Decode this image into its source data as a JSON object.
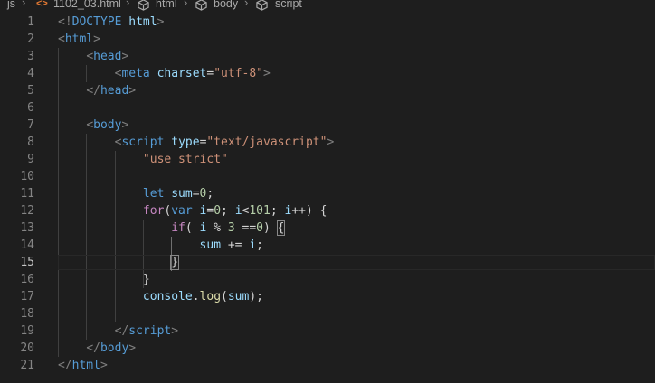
{
  "breadcrumb": {
    "folder": "js",
    "file": "1102_03.html",
    "html": "html",
    "body": "body",
    "script": "script"
  },
  "editor": {
    "current_line": 15,
    "lines": [
      {
        "n": "1",
        "tokens": [
          {
            "t": "<!",
            "c": "punc"
          },
          {
            "t": "DOCTYPE",
            "c": "tag"
          },
          {
            "t": " ",
            "c": "plain"
          },
          {
            "t": "html",
            "c": "attr"
          },
          {
            "t": ">",
            "c": "punc"
          }
        ]
      },
      {
        "n": "2",
        "tokens": [
          {
            "t": "<",
            "c": "punc"
          },
          {
            "t": "html",
            "c": "tag"
          },
          {
            "t": ">",
            "c": "punc"
          }
        ]
      },
      {
        "n": "3",
        "tokens": [
          {
            "t": "    ",
            "c": "plain"
          },
          {
            "t": "<",
            "c": "punc"
          },
          {
            "t": "head",
            "c": "tag"
          },
          {
            "t": ">",
            "c": "punc"
          }
        ]
      },
      {
        "n": "4",
        "tokens": [
          {
            "t": "        ",
            "c": "plain"
          },
          {
            "t": "<",
            "c": "punc"
          },
          {
            "t": "meta",
            "c": "tag"
          },
          {
            "t": " ",
            "c": "plain"
          },
          {
            "t": "charset",
            "c": "attr"
          },
          {
            "t": "=",
            "c": "plain"
          },
          {
            "t": "\"utf-8\"",
            "c": "str"
          },
          {
            "t": ">",
            "c": "punc"
          }
        ]
      },
      {
        "n": "5",
        "tokens": [
          {
            "t": "    ",
            "c": "plain"
          },
          {
            "t": "</",
            "c": "punc"
          },
          {
            "t": "head",
            "c": "tag"
          },
          {
            "t": ">",
            "c": "punc"
          }
        ]
      },
      {
        "n": "6",
        "tokens": []
      },
      {
        "n": "7",
        "tokens": [
          {
            "t": "    ",
            "c": "plain"
          },
          {
            "t": "<",
            "c": "punc"
          },
          {
            "t": "body",
            "c": "tag"
          },
          {
            "t": ">",
            "c": "punc"
          }
        ]
      },
      {
        "n": "8",
        "tokens": [
          {
            "t": "        ",
            "c": "plain"
          },
          {
            "t": "<",
            "c": "punc"
          },
          {
            "t": "script",
            "c": "tag"
          },
          {
            "t": " ",
            "c": "plain"
          },
          {
            "t": "type",
            "c": "attr"
          },
          {
            "t": "=",
            "c": "plain"
          },
          {
            "t": "\"text/javascript\"",
            "c": "str"
          },
          {
            "t": ">",
            "c": "punc"
          }
        ]
      },
      {
        "n": "9",
        "tokens": [
          {
            "t": "            ",
            "c": "plain"
          },
          {
            "t": "\"use strict\"",
            "c": "str"
          }
        ]
      },
      {
        "n": "10",
        "tokens": []
      },
      {
        "n": "11",
        "tokens": [
          {
            "t": "            ",
            "c": "plain"
          },
          {
            "t": "let",
            "c": "kw"
          },
          {
            "t": " ",
            "c": "plain"
          },
          {
            "t": "sum",
            "c": "var"
          },
          {
            "t": "=",
            "c": "plain"
          },
          {
            "t": "0",
            "c": "num"
          },
          {
            "t": ";",
            "c": "plain"
          }
        ]
      },
      {
        "n": "12",
        "tokens": [
          {
            "t": "            ",
            "c": "plain"
          },
          {
            "t": "for",
            "c": "ctrl"
          },
          {
            "t": "(",
            "c": "plain"
          },
          {
            "t": "var",
            "c": "kw"
          },
          {
            "t": " ",
            "c": "plain"
          },
          {
            "t": "i",
            "c": "var"
          },
          {
            "t": "=",
            "c": "plain"
          },
          {
            "t": "0",
            "c": "num"
          },
          {
            "t": "; ",
            "c": "plain"
          },
          {
            "t": "i",
            "c": "var"
          },
          {
            "t": "<",
            "c": "plain"
          },
          {
            "t": "101",
            "c": "num"
          },
          {
            "t": "; ",
            "c": "plain"
          },
          {
            "t": "i",
            "c": "var"
          },
          {
            "t": "++) {",
            "c": "plain"
          }
        ]
      },
      {
        "n": "13",
        "tokens": [
          {
            "t": "                ",
            "c": "plain"
          },
          {
            "t": "if",
            "c": "ctrl"
          },
          {
            "t": "( ",
            "c": "plain"
          },
          {
            "t": "i",
            "c": "var"
          },
          {
            "t": " % ",
            "c": "plain"
          },
          {
            "t": "3",
            "c": "num"
          },
          {
            "t": " ==",
            "c": "plain"
          },
          {
            "t": "0",
            "c": "num"
          },
          {
            "t": ") ",
            "c": "plain"
          },
          {
            "t": "{",
            "c": "plain",
            "m": true
          }
        ]
      },
      {
        "n": "14",
        "tokens": [
          {
            "t": "                    ",
            "c": "plain"
          },
          {
            "t": "sum",
            "c": "var"
          },
          {
            "t": " += ",
            "c": "plain"
          },
          {
            "t": "i",
            "c": "var"
          },
          {
            "t": ";",
            "c": "plain"
          }
        ]
      },
      {
        "n": "15",
        "tokens": [
          {
            "t": "                ",
            "c": "plain"
          },
          {
            "t": "}",
            "c": "plain",
            "m": true
          }
        ]
      },
      {
        "n": "16",
        "tokens": [
          {
            "t": "            ",
            "c": "plain"
          },
          {
            "t": "}",
            "c": "plain"
          }
        ]
      },
      {
        "n": "17",
        "tokens": [
          {
            "t": "            ",
            "c": "plain"
          },
          {
            "t": "console",
            "c": "var"
          },
          {
            "t": ".",
            "c": "plain"
          },
          {
            "t": "log",
            "c": "fn"
          },
          {
            "t": "(",
            "c": "plain"
          },
          {
            "t": "sum",
            "c": "var"
          },
          {
            "t": ");",
            "c": "plain"
          }
        ]
      },
      {
        "n": "18",
        "tokens": []
      },
      {
        "n": "19",
        "tokens": [
          {
            "t": "        ",
            "c": "plain"
          },
          {
            "t": "</",
            "c": "punc"
          },
          {
            "t": "script",
            "c": "tag"
          },
          {
            "t": ">",
            "c": "punc"
          }
        ]
      },
      {
        "n": "20",
        "tokens": [
          {
            "t": "    ",
            "c": "plain"
          },
          {
            "t": "</",
            "c": "punc"
          },
          {
            "t": "body",
            "c": "tag"
          },
          {
            "t": ">",
            "c": "punc"
          }
        ]
      },
      {
        "n": "21",
        "tokens": [
          {
            "t": "</",
            "c": "punc"
          },
          {
            "t": "html",
            "c": "tag"
          },
          {
            "t": ">",
            "c": "punc"
          }
        ]
      }
    ]
  },
  "colors": {
    "background": "#1e1e1e",
    "tag": "#569cd6",
    "attribute": "#9cdcfe",
    "string": "#ce9178",
    "keyword": "#569cd6",
    "control": "#c586c0",
    "number": "#b5cea8",
    "function": "#dcdcaa",
    "line_number": "#858585"
  }
}
